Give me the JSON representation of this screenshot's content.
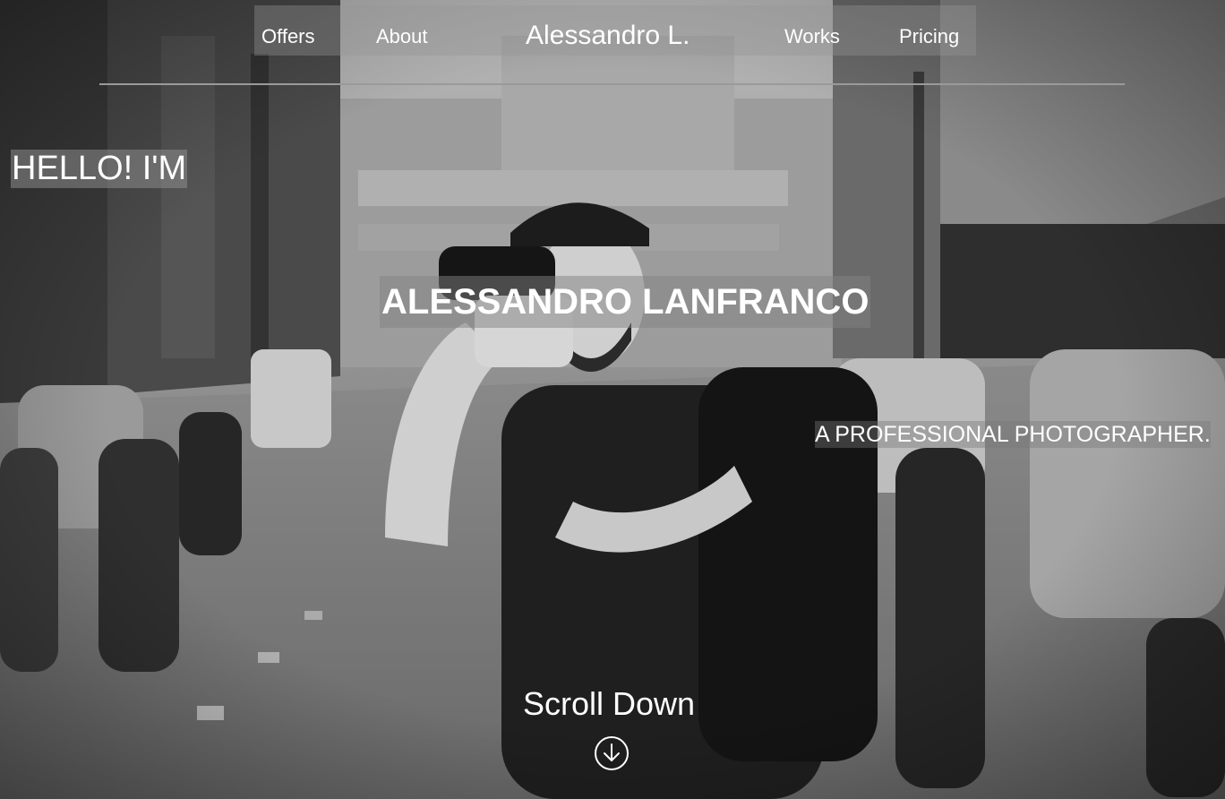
{
  "nav": {
    "links": [
      {
        "label": "Offers"
      },
      {
        "label": "About"
      },
      {
        "label": "Works"
      },
      {
        "label": "Pricing"
      }
    ],
    "brand": "Alessandro L."
  },
  "hero": {
    "greeting": "HELLO! I'M",
    "name": "ALESSANDRO LANFRANCO",
    "subtitle": "A PROFESSIONAL PHOTOGRAPHER.",
    "scroll_label": "Scroll Down",
    "scroll_icon": "arrow-down-circle-icon",
    "background": "black-and-white-street-photographer-photo"
  }
}
